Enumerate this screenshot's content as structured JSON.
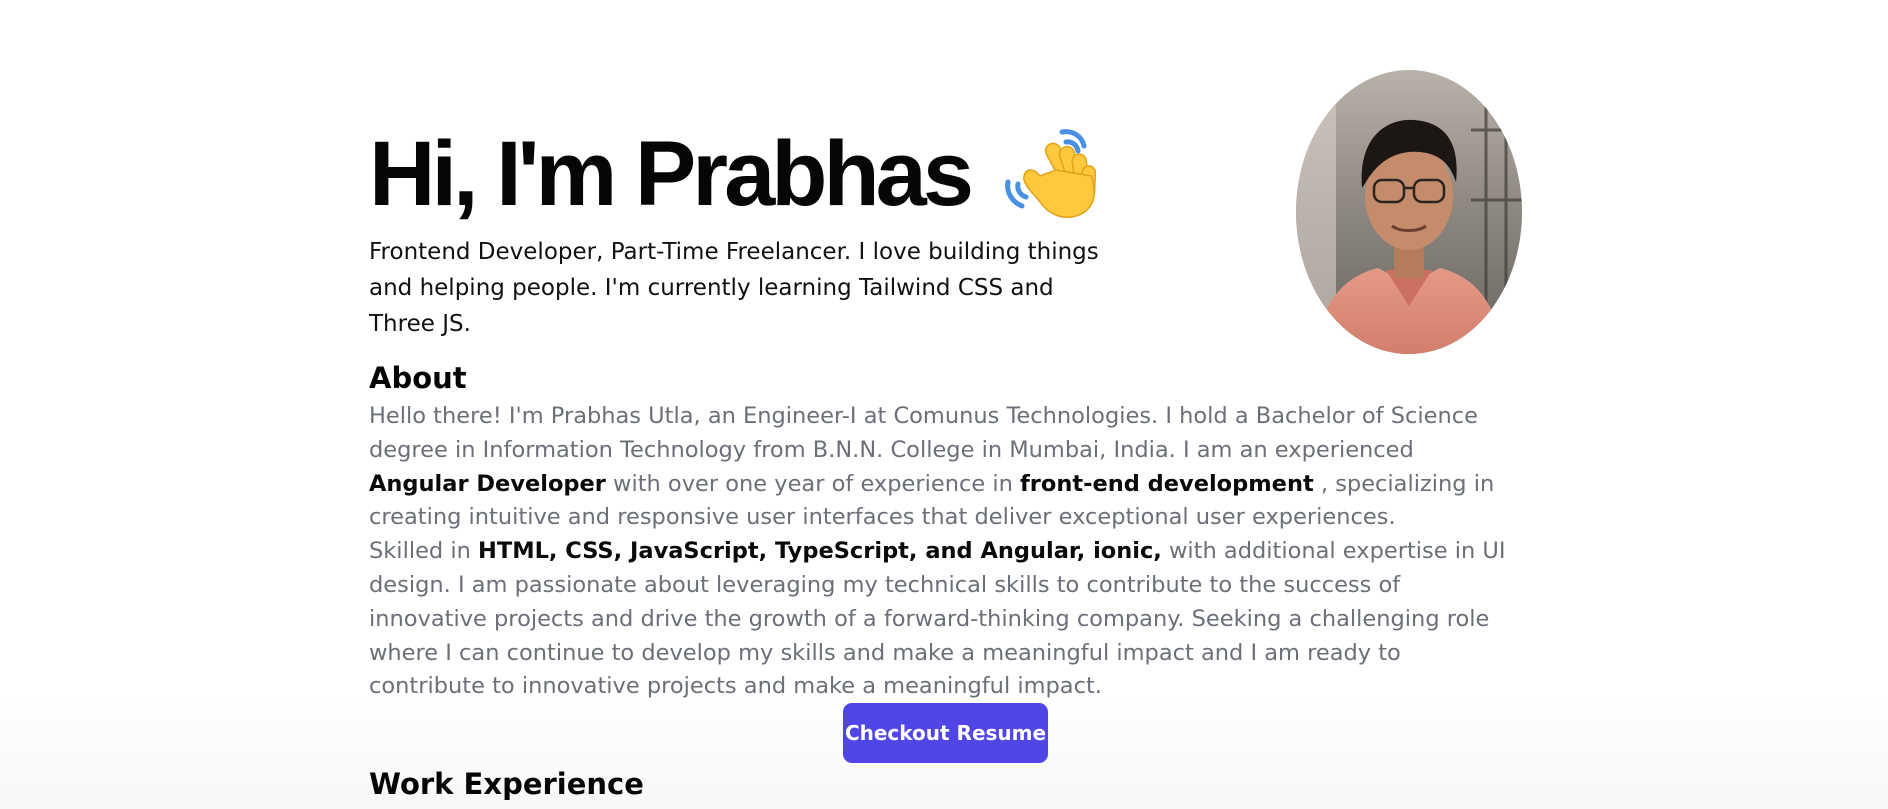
{
  "hero": {
    "title": "Hi, I'm Prabhas",
    "subtitle": "Frontend Developer, Part-Time Freelancer. I love building things and helping people. I'm currently learning Tailwind CSS and Three JS.",
    "icon": "waving-hand-icon"
  },
  "about": {
    "heading": "About",
    "p1_a": "Hello there! I'm Prabhas Utla, an Engineer-I at Comunus Technologies. I hold a Bachelor of Science degree in Information Technology from B.N.N. College in Mumbai, India. I am an experienced ",
    "p1_b": "Angular Developer",
    "p1_c": " with over one year of experience in ",
    "p1_d": "front-end development",
    "p1_e": " , specializing in creating intuitive and responsive user interfaces that deliver exceptional user experiences.",
    "p2_a": "Skilled in ",
    "p2_b": "HTML, CSS, JavaScript, TypeScript, and Angular, ionic,",
    "p2_c": " with additional expertise in UI design. I am passionate about leveraging my technical skills to contribute to the success of innovative projects and drive the growth of a forward-thinking company. Seeking a challenging role where I can continue to develop my skills and make a meaningful impact and I am ready to contribute to innovative projects and make a meaningful impact."
  },
  "resume_button": {
    "label": "Checkout Resume",
    "color": "#4f46e5"
  },
  "work": {
    "heading": "Work Experience"
  },
  "colors": {
    "muted_text": "#6b6f78",
    "heading_text": "#050505"
  }
}
